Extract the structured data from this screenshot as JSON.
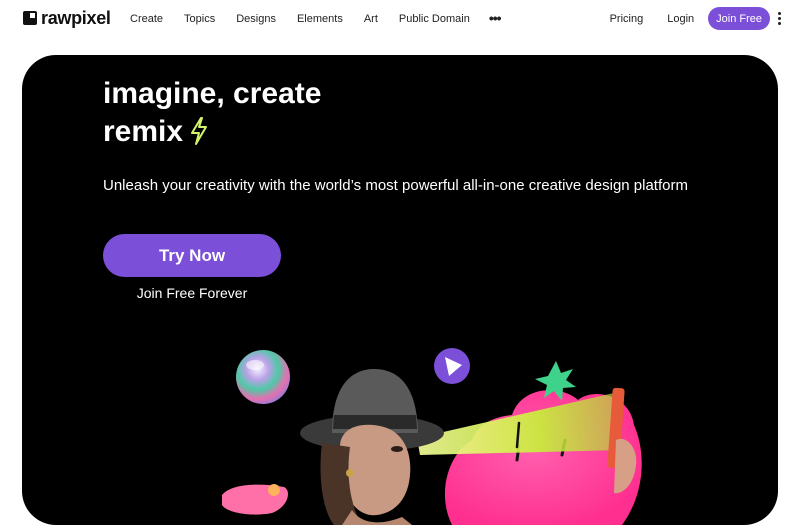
{
  "brand": {
    "name": "rawpixel"
  },
  "nav": {
    "links": [
      "Create",
      "Topics",
      "Designs",
      "Elements",
      "Art",
      "Public Domain"
    ],
    "more_icon": "more-dots-icon",
    "pricing": "Pricing",
    "login": "Login",
    "join": "Join Free",
    "menu_icon": "kebab-menu-icon"
  },
  "hero": {
    "headline_line1": "imagine, create",
    "headline_line2": "remix",
    "headline_icon": "lightning-bolt-icon",
    "subtitle": "Unleash your creativity with the world’s most powerful all-in-one creative design platform",
    "cta": "Try Now",
    "secondary": "Join Free Forever"
  },
  "colors": {
    "accent": "#7c4fd8",
    "hero_bg": "#000000",
    "bolt": "#d4f36a"
  }
}
